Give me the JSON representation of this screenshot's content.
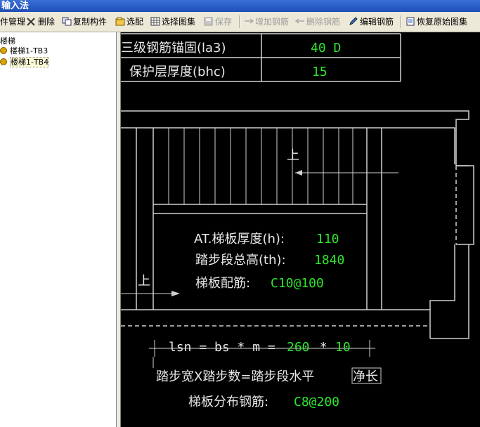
{
  "window": {
    "title": "输入法"
  },
  "toolbar": {
    "items": [
      {
        "label": "件管理",
        "enabled": true
      },
      {
        "label": "删除",
        "enabled": true
      },
      {
        "label": "复制构件",
        "enabled": true
      },
      {
        "label": "选配",
        "enabled": true
      },
      {
        "label": "选择图集",
        "enabled": true
      },
      {
        "label": "保存",
        "enabled": false
      },
      {
        "label": "增加钢筋",
        "enabled": false
      },
      {
        "label": "删除钢筋",
        "enabled": false
      },
      {
        "label": "编辑钢筋",
        "enabled": true
      },
      {
        "label": "恢复原始图集",
        "enabled": true
      }
    ]
  },
  "tree": {
    "root": "楼梯",
    "items": [
      {
        "label": "楼梯1-TB3",
        "selected": false
      },
      {
        "label": "楼梯1-TB4",
        "selected": true
      }
    ]
  },
  "drawing": {
    "table": [
      {
        "label": "三级钢筋锚固(la3)",
        "value": "40 D"
      },
      {
        "label": "保护层厚度(bhc)",
        "value": "15"
      }
    ],
    "up_label_top": "上",
    "up_label_left": "上",
    "params": [
      {
        "label": "AT.梯板厚度(h):",
        "value": "110"
      },
      {
        "label": "踏步段总高(th):",
        "value": "1840"
      },
      {
        "label": "梯板配筋:",
        "value": "C10@100"
      }
    ],
    "formula": {
      "prefix": "lsn = bs * m = ",
      "a": "260",
      "op": " * ",
      "b": "10"
    },
    "formula_text_a": "踏步宽X踏步数=踏步段水平",
    "formula_text_b": "净长",
    "dist_label": "梯板分布钢筋:",
    "dist_value": "C8@200"
  },
  "colors": {
    "cad_value": "#2ee52e",
    "cad_line": "#e8e8e8",
    "cad_bg": "#000000"
  }
}
